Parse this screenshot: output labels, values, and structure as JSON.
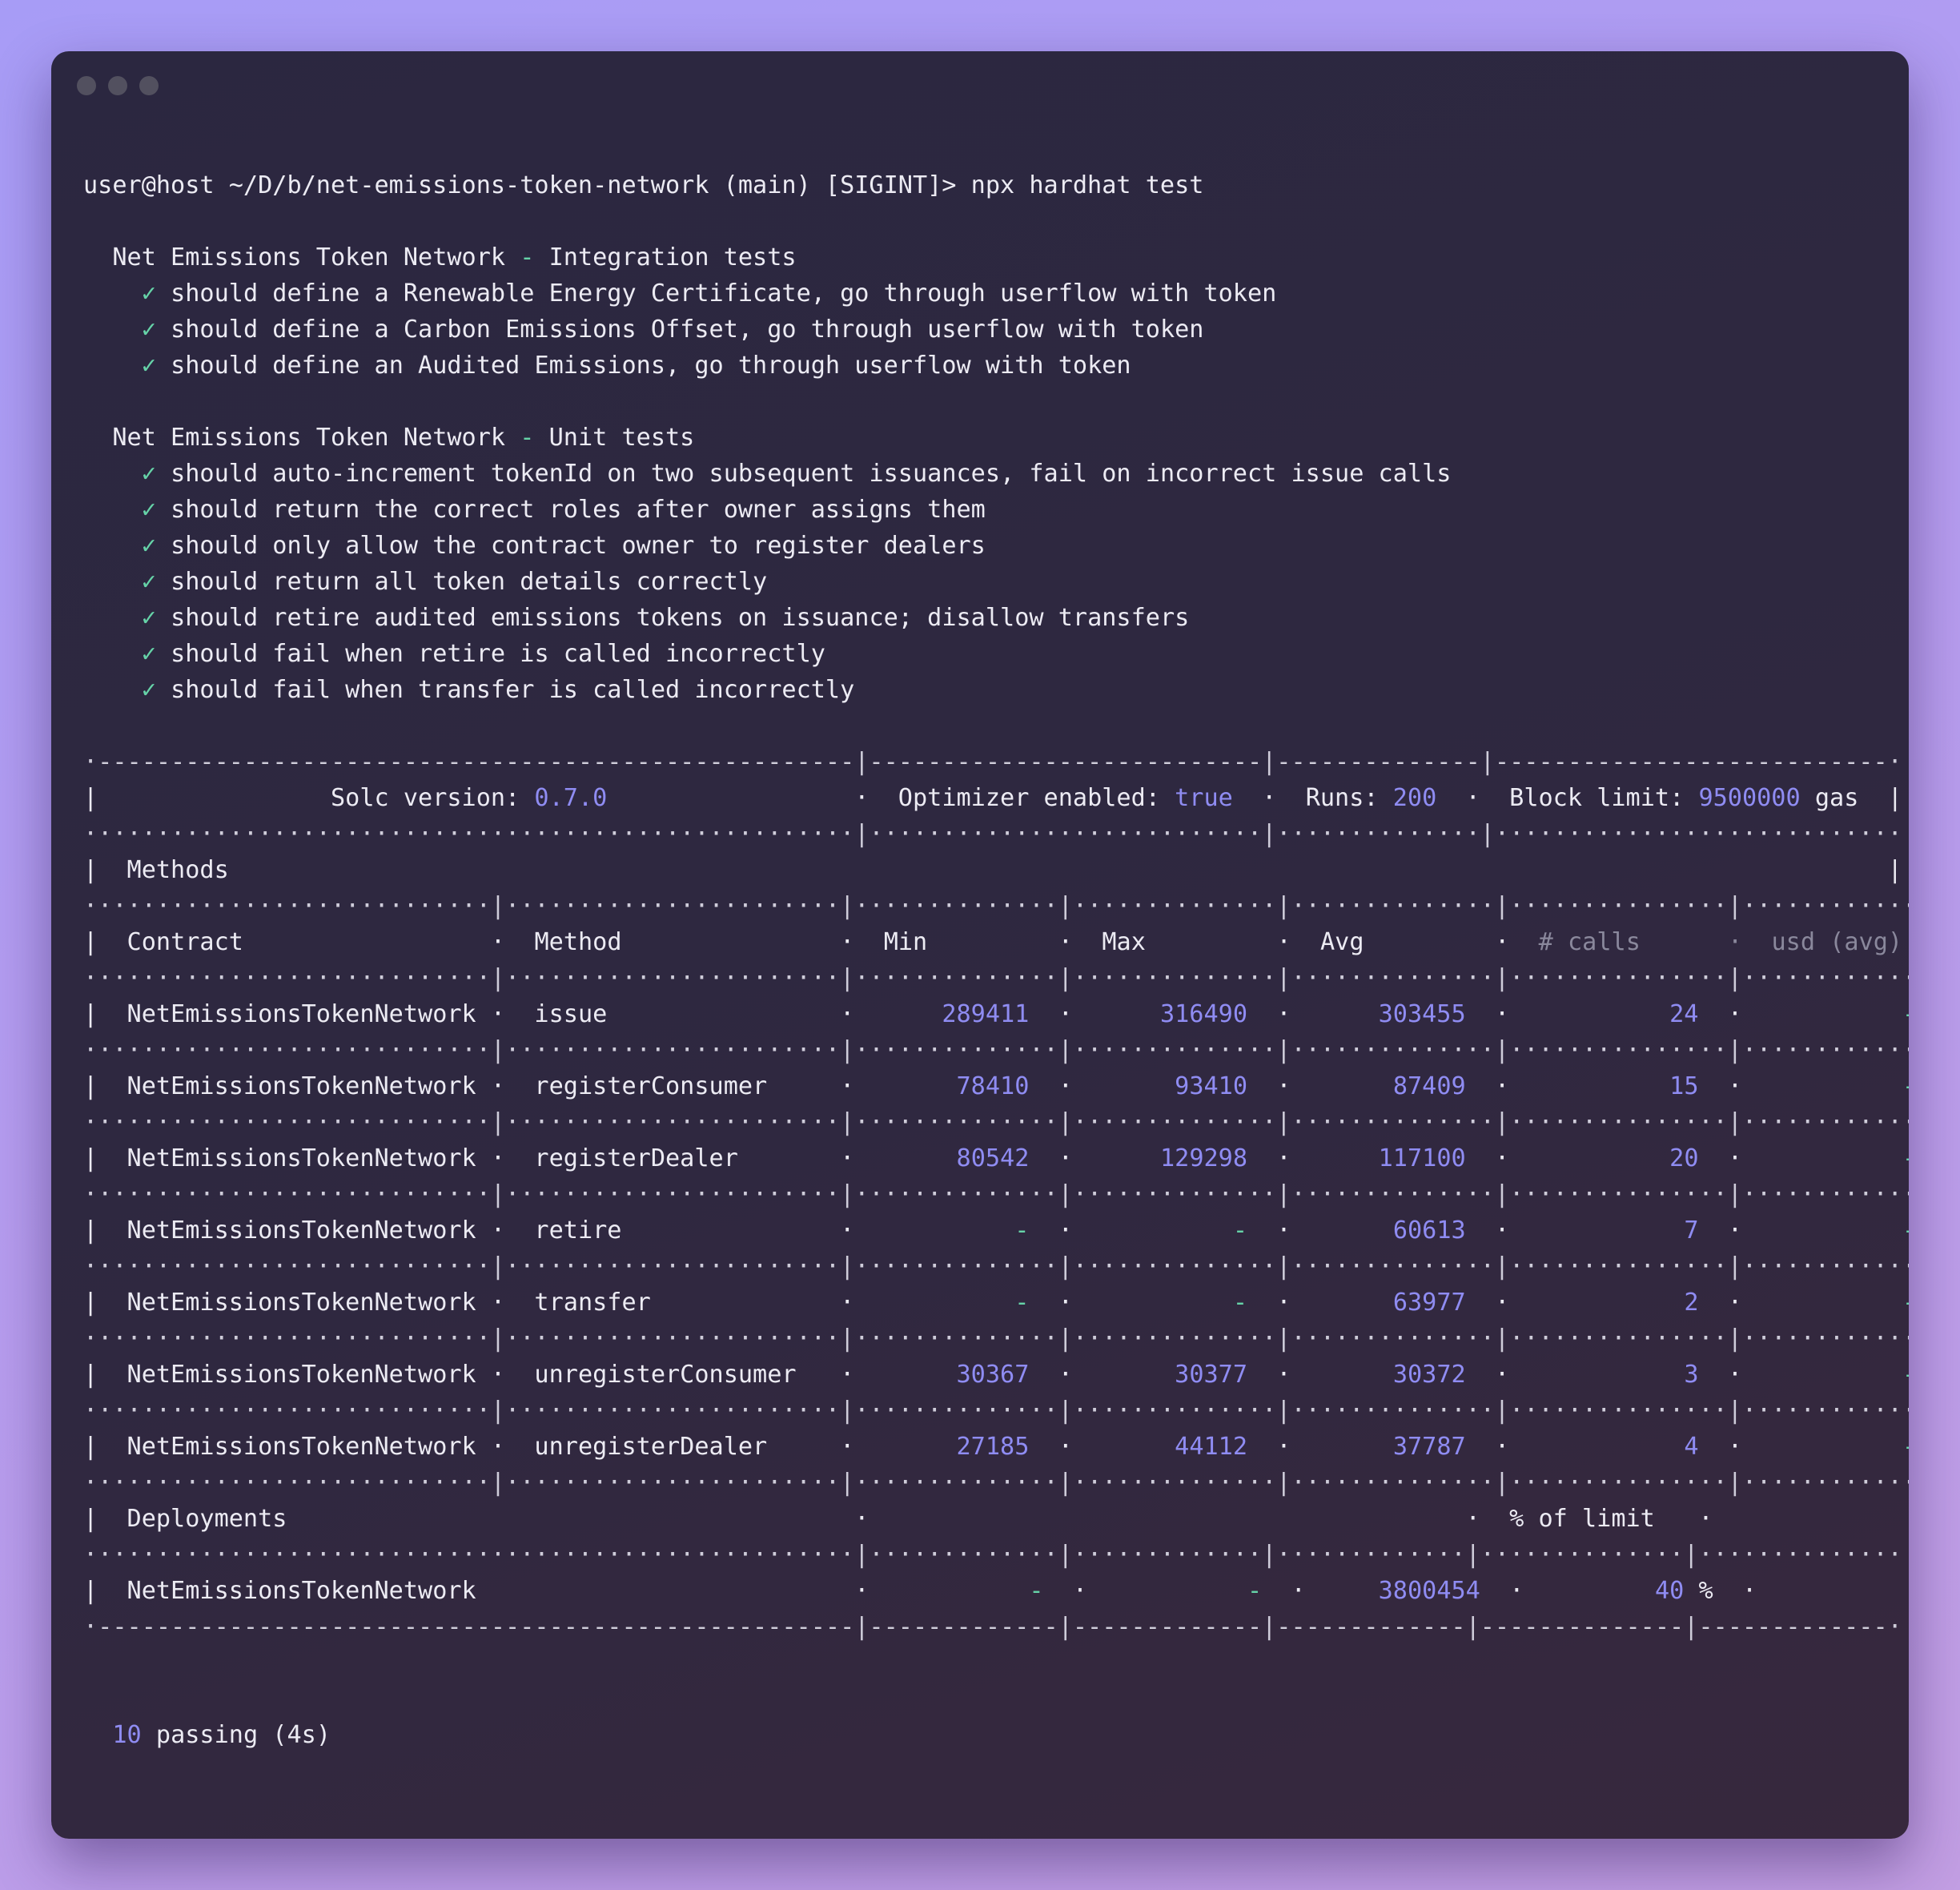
{
  "prompt": {
    "text": "user@host ~/D/b/net-emissions-token-network (main) [SIGINT]> ",
    "command": "npx hardhat test"
  },
  "suites": [
    {
      "name": "Net Emissions Token Network",
      "type": "Integration tests",
      "tests": [
        "should define a Renewable Energy Certificate, go through userflow with token",
        "should define a Carbon Emissions Offset, go through userflow with token",
        "should define an Audited Emissions, go through userflow with token"
      ]
    },
    {
      "name": "Net Emissions Token Network",
      "type": "Unit tests",
      "tests": [
        "should auto-increment tokenId on two subsequent issuances, fail on incorrect issue calls",
        "should return the correct roles after owner assigns them",
        "should only allow the contract owner to register dealers",
        "should return all token details correctly",
        "should retire audited emissions tokens on issuance; disallow transfers",
        "should fail when retire is called incorrectly",
        "should fail when transfer is called incorrectly"
      ]
    }
  ],
  "gas_report": {
    "solc_label": "Solc version: ",
    "solc_version": "0.7.0",
    "optimizer_label": "Optimizer enabled: ",
    "optimizer_value": "true",
    "runs_label": "Runs: ",
    "runs_value": "200",
    "block_label": "Block limit: ",
    "block_value": "9500000",
    "block_unit": "gas",
    "methods_title": "Methods",
    "columns": [
      "Contract",
      "Method",
      "Min",
      "Max",
      "Avg",
      "# calls",
      "usd (avg)"
    ],
    "methods": [
      {
        "contract": "NetEmissionsTokenNetwork",
        "method": "issue",
        "min": "289411",
        "max": "316490",
        "avg": "303455",
        "calls": "24",
        "usd": "-"
      },
      {
        "contract": "NetEmissionsTokenNetwork",
        "method": "registerConsumer",
        "min": "78410",
        "max": "93410",
        "avg": "87409",
        "calls": "15",
        "usd": "-"
      },
      {
        "contract": "NetEmissionsTokenNetwork",
        "method": "registerDealer",
        "min": "80542",
        "max": "129298",
        "avg": "117100",
        "calls": "20",
        "usd": "-"
      },
      {
        "contract": "NetEmissionsTokenNetwork",
        "method": "retire",
        "min": "-",
        "max": "-",
        "avg": "60613",
        "calls": "7",
        "usd": "-"
      },
      {
        "contract": "NetEmissionsTokenNetwork",
        "method": "transfer",
        "min": "-",
        "max": "-",
        "avg": "63977",
        "calls": "2",
        "usd": "-"
      },
      {
        "contract": "NetEmissionsTokenNetwork",
        "method": "unregisterConsumer",
        "min": "30367",
        "max": "30377",
        "avg": "30372",
        "calls": "3",
        "usd": "-"
      },
      {
        "contract": "NetEmissionsTokenNetwork",
        "method": "unregisterDealer",
        "min": "27185",
        "max": "44112",
        "avg": "37787",
        "calls": "4",
        "usd": "-"
      }
    ],
    "deployments_title": "Deployments",
    "percent_label": "% of limit",
    "deployments": [
      {
        "contract": "NetEmissionsTokenNetwork",
        "min": "-",
        "max": "-",
        "avg": "3800454",
        "percent": "40",
        "usd": "-"
      }
    ]
  },
  "summary": {
    "count": "10",
    "text": "passing (4s)"
  },
  "colors": {
    "number": "#8f8cf2",
    "dash": "#66d3a8",
    "muted": "#8a889c",
    "text": "#ecebf3"
  }
}
